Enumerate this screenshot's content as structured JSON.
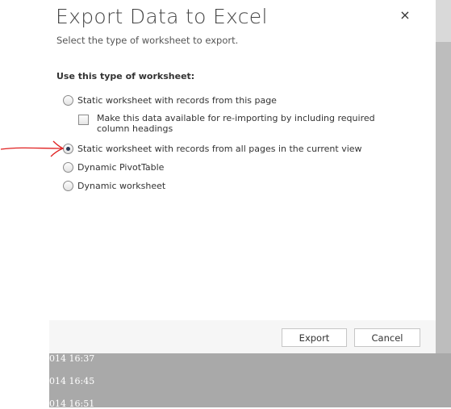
{
  "dialog": {
    "title": "Export Data to Excel",
    "subtitle": "Select the type of worksheet to export.",
    "close_icon": "×",
    "section_label": "Use this type of worksheet:",
    "options": [
      {
        "label": "Static worksheet with records from this page",
        "checked": false
      },
      {
        "label": "Static worksheet with records from all pages in the current view",
        "checked": true
      },
      {
        "label": "Dynamic PivotTable",
        "checked": false
      },
      {
        "label": "Dynamic worksheet",
        "checked": false
      }
    ],
    "reimport_checkbox": {
      "label": "Make this data available for re-importing by including required column headings",
      "checked": false
    },
    "buttons": {
      "export_label": "Export",
      "cancel_label": "Cancel"
    }
  },
  "background_rows": [
    "014 16:37",
    "014 16:45",
    "014 16:51"
  ],
  "colors": {
    "annotation_arrow": "#e02020",
    "backdrop": "#a9a9a9",
    "footer": "#f6f6f6"
  }
}
